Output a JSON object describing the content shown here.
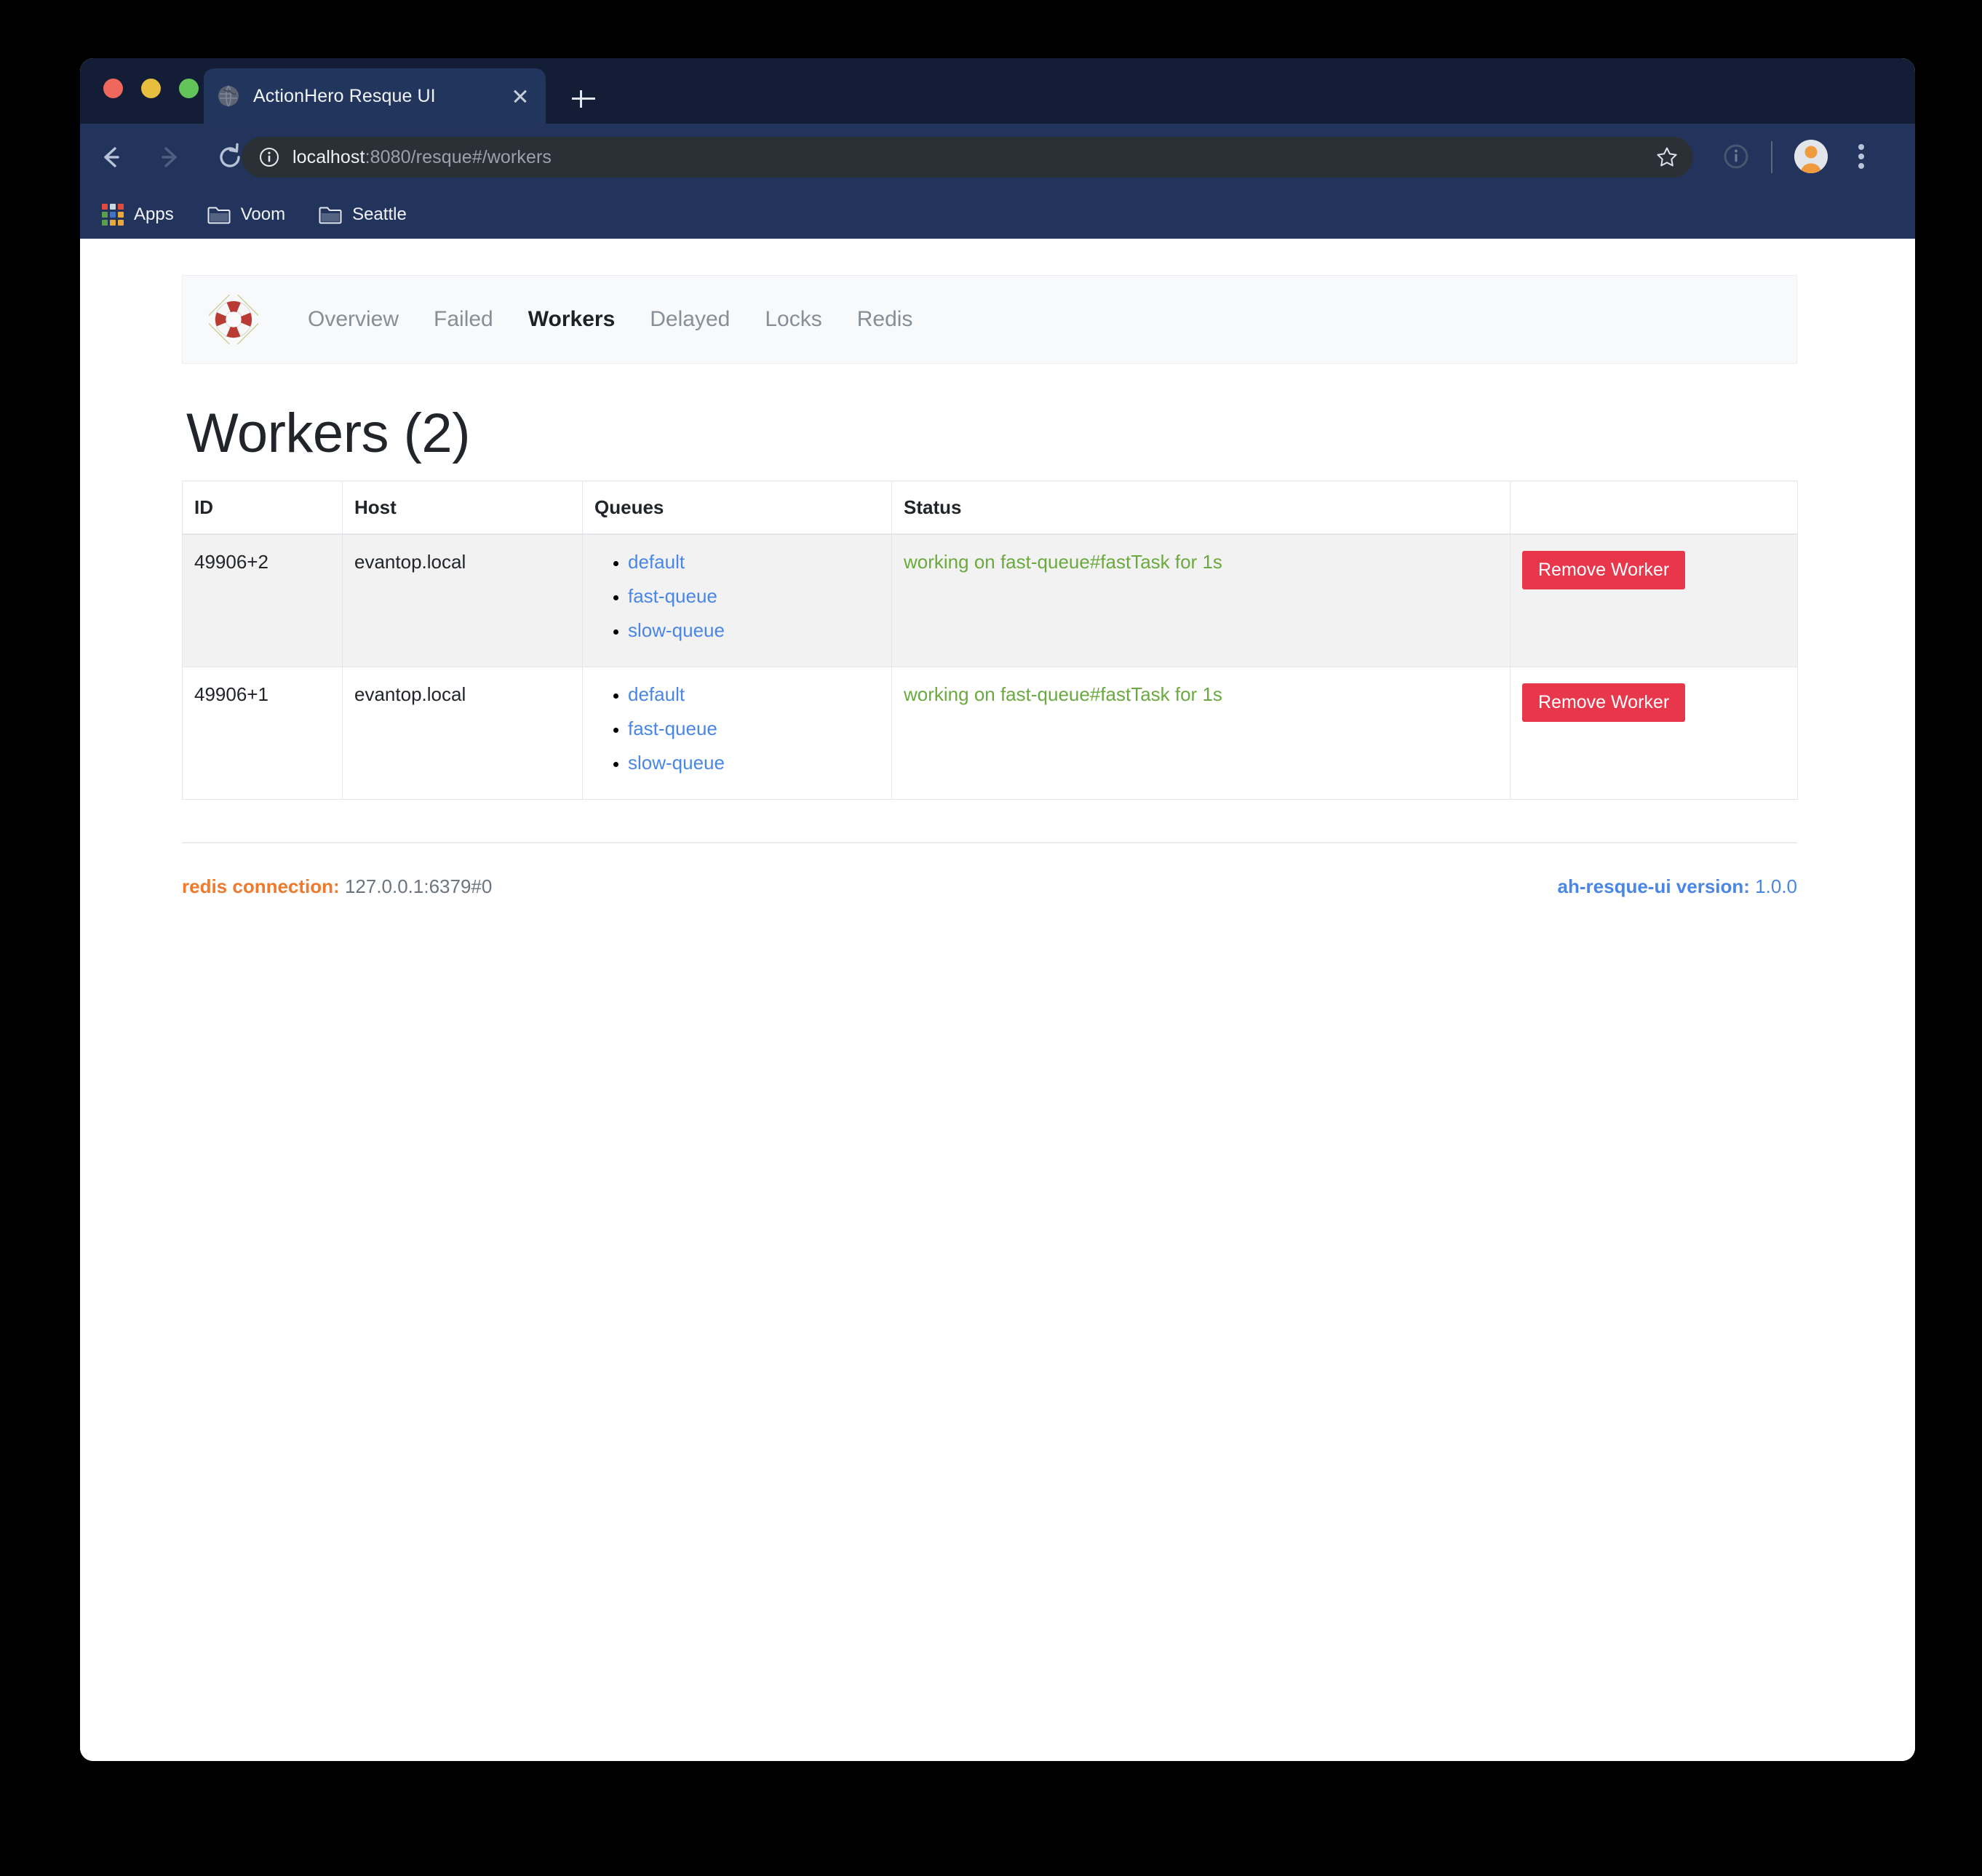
{
  "browser": {
    "traffic_lights": [
      "close",
      "minimize",
      "maximize"
    ],
    "tab": {
      "title": "ActionHero Resque UI",
      "favicon": "globe-icon",
      "close_icon": "close-icon"
    },
    "new_tab_icon": "plus-icon",
    "toolbar": {
      "back_icon": "arrow-left-icon",
      "forward_icon": "arrow-right-icon",
      "reload_icon": "reload-icon",
      "site_info_icon": "info-circle-icon",
      "url_host": "localhost",
      "url_rest": ":8080/resque#/workers",
      "url_full": "localhost:8080/resque#/workers",
      "bookmark_star_icon": "star-icon",
      "extension_icon": "info-badge-icon",
      "avatar_icon": "avatar-icon",
      "menu_icon": "kebab-menu-icon"
    },
    "bookmarks": [
      {
        "label": "Apps",
        "icon": "apps-grid-icon"
      },
      {
        "label": "Voom",
        "icon": "folder-icon"
      },
      {
        "label": "Seattle",
        "icon": "folder-icon"
      }
    ]
  },
  "app": {
    "logo_icon": "lifebuoy-icon",
    "nav": [
      {
        "label": "Overview",
        "active": false
      },
      {
        "label": "Failed",
        "active": false
      },
      {
        "label": "Workers",
        "active": true
      },
      {
        "label": "Delayed",
        "active": false
      },
      {
        "label": "Locks",
        "active": false
      },
      {
        "label": "Redis",
        "active": false
      }
    ],
    "page_title": "Workers (2)",
    "table": {
      "headers": [
        "ID",
        "Host",
        "Queues",
        "Status",
        ""
      ],
      "rows": [
        {
          "id": "49906+2",
          "host": "evantop.local",
          "queues": [
            "default",
            "fast-queue",
            "slow-queue"
          ],
          "status": "working on fast-queue#fastTask for 1s",
          "action_label": "Remove Worker"
        },
        {
          "id": "49906+1",
          "host": "evantop.local",
          "queues": [
            "default",
            "fast-queue",
            "slow-queue"
          ],
          "status": "working on fast-queue#fastTask for 1s",
          "action_label": "Remove Worker"
        }
      ]
    },
    "footer": {
      "redis_label": "redis connection:",
      "redis_value": "127.0.0.1:6379#0",
      "version_label": "ah-resque-ui version:",
      "version_value": "1.0.0"
    }
  },
  "colors": {
    "browser_tabstrip": "#131e36",
    "browser_toolbar": "#22345c",
    "omnibox": "#2b2f36",
    "danger_button": "#e8364b",
    "queue_link": "#4a86e8",
    "status_green": "#6aaa3f",
    "redis_orange": "#f2792b",
    "navbar_bg": "#f8f9fa"
  }
}
